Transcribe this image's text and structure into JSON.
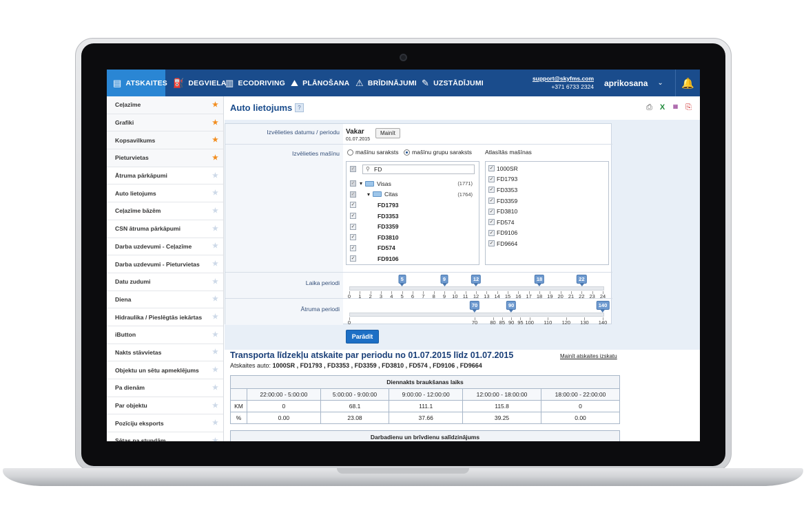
{
  "nav": {
    "items": [
      {
        "label": "ATSKAITES",
        "icon": "report-icon"
      },
      {
        "label": "DEGVIELA",
        "icon": "fuel-icon"
      },
      {
        "label": "ECODRIVING",
        "icon": "bar-chart-icon"
      },
      {
        "label": "PLĀNOŠANA",
        "icon": "route-icon"
      },
      {
        "label": "BRĪDINĀJUMI",
        "icon": "warning-icon"
      },
      {
        "label": "UZSTĀDĪJUMI",
        "icon": "wrench-icon"
      }
    ],
    "support_email": "support@skyfms.com",
    "support_phone": "+371 6733 2324",
    "user": "aprikosana"
  },
  "sidebar": {
    "items": [
      {
        "label": "Ceļazīme",
        "fav": true
      },
      {
        "label": "Grafiki",
        "fav": true
      },
      {
        "label": "Kopsavilkums",
        "fav": true
      },
      {
        "label": "Pieturvietas",
        "fav": true
      },
      {
        "label": "Ātruma pārkāpumi",
        "fav": false
      },
      {
        "label": "Auto lietojums",
        "fav": false
      },
      {
        "label": "Ceļazīme bāzēm",
        "fav": false
      },
      {
        "label": "CSN ātruma pārkāpumi",
        "fav": false
      },
      {
        "label": "Darba uzdevumi - Ceļazīme",
        "fav": false
      },
      {
        "label": "Darba uzdevumi - Pieturvietas",
        "fav": false
      },
      {
        "label": "Datu zudumi",
        "fav": false
      },
      {
        "label": "Diena",
        "fav": false
      },
      {
        "label": "Hidraulika / Pieslēgtās iekārtas",
        "fav": false
      },
      {
        "label": "iButton",
        "fav": false
      },
      {
        "label": "Nakts stāvvietas",
        "fav": false
      },
      {
        "label": "Objektu un sētu apmeklējums",
        "fav": false
      },
      {
        "label": "Pa dienām",
        "fav": false
      },
      {
        "label": "Par objektu",
        "fav": false
      },
      {
        "label": "Pozīciju eksports",
        "fav": false
      },
      {
        "label": "Sētas pa stundām",
        "fav": false
      }
    ]
  },
  "page": {
    "title": "Auto lietojums",
    "help": "?",
    "export_icons": [
      "print-icon",
      "excel-icon",
      "csv-icon",
      "pdf-icon"
    ]
  },
  "form": {
    "period_label": "Izvēlieties datumu / periodu",
    "period_value": "Vakar",
    "period_date": "01.07.2015",
    "change_button": "Mainīt",
    "vehicle_label": "Izvēlieties mašīnu",
    "radio_list": "mašīnu saraksts",
    "radio_groups": "mašīnu grupu saraksts",
    "radio_selected": "groups",
    "search_value": "FD",
    "tree": [
      {
        "label": "Visas",
        "count": "(1771)",
        "level": 0,
        "folder": true
      },
      {
        "label": "Citas",
        "count": "(1764)",
        "level": 1,
        "folder": true
      },
      {
        "label": "FD1793",
        "count": "",
        "level": 2,
        "folder": false
      },
      {
        "label": "FD3353",
        "count": "",
        "level": 2,
        "folder": false
      },
      {
        "label": "FD3359",
        "count": "",
        "level": 2,
        "folder": false
      },
      {
        "label": "FD3810",
        "count": "",
        "level": 2,
        "folder": false
      },
      {
        "label": "FD574",
        "count": "",
        "level": 2,
        "folder": false
      },
      {
        "label": "FD9106",
        "count": "",
        "level": 2,
        "folder": false
      }
    ],
    "selected_label": "Atlasītās mašīnas",
    "selected": [
      "1000SR",
      "FD1793",
      "FD3353",
      "FD3359",
      "FD3810",
      "FD574",
      "FD9106",
      "FD9664"
    ],
    "time_label": "Laika periodi",
    "time_ticks": [
      "0",
      "1",
      "2",
      "3",
      "4",
      "5",
      "6",
      "7",
      "8",
      "9",
      "10",
      "11",
      "12",
      "13",
      "14",
      "15",
      "16",
      "17",
      "18",
      "19",
      "20",
      "21",
      "22",
      "23",
      "24"
    ],
    "time_handles": [
      "5",
      "9",
      "12",
      "18",
      "22"
    ],
    "speed_label": "Ātruma periodi",
    "speed_ticks": [
      "0",
      "70",
      "80",
      "85",
      "90",
      "95",
      "100",
      "110",
      "120",
      "130",
      "140"
    ],
    "speed_handles": [
      "70",
      "90",
      "140"
    ],
    "show_button": "Parādīt"
  },
  "report": {
    "title": "Transporta līdzekļu atskaite par periodu no 01.07.2015 līdz 01.07.2015",
    "change_view": "Mainīt atskaites izskatu",
    "auto_label": "Atskaites auto:",
    "auto_list": "1000SR , FD1793 , FD3353 , FD3359 , FD3810 , FD574 , FD9106 , FD9664",
    "table1": {
      "caption": "Diennakts braukšanas laiks",
      "columns": [
        "22:00:00 - 5:00:00",
        "5:00:00 - 9:00:00",
        "9:00:00 - 12:00:00",
        "12:00:00 - 18:00:00",
        "18:00:00 - 22:00:00"
      ],
      "rows": [
        {
          "label": "KM",
          "values": [
            "0",
            "68.1",
            "111.1",
            "115.8",
            "0"
          ]
        },
        {
          "label": "%",
          "values": [
            "0.00",
            "23.08",
            "37.66",
            "39.25",
            "0.00"
          ]
        }
      ]
    },
    "table2": {
      "caption": "Darbadienu un brīvdienu salīdzinājums"
    }
  }
}
